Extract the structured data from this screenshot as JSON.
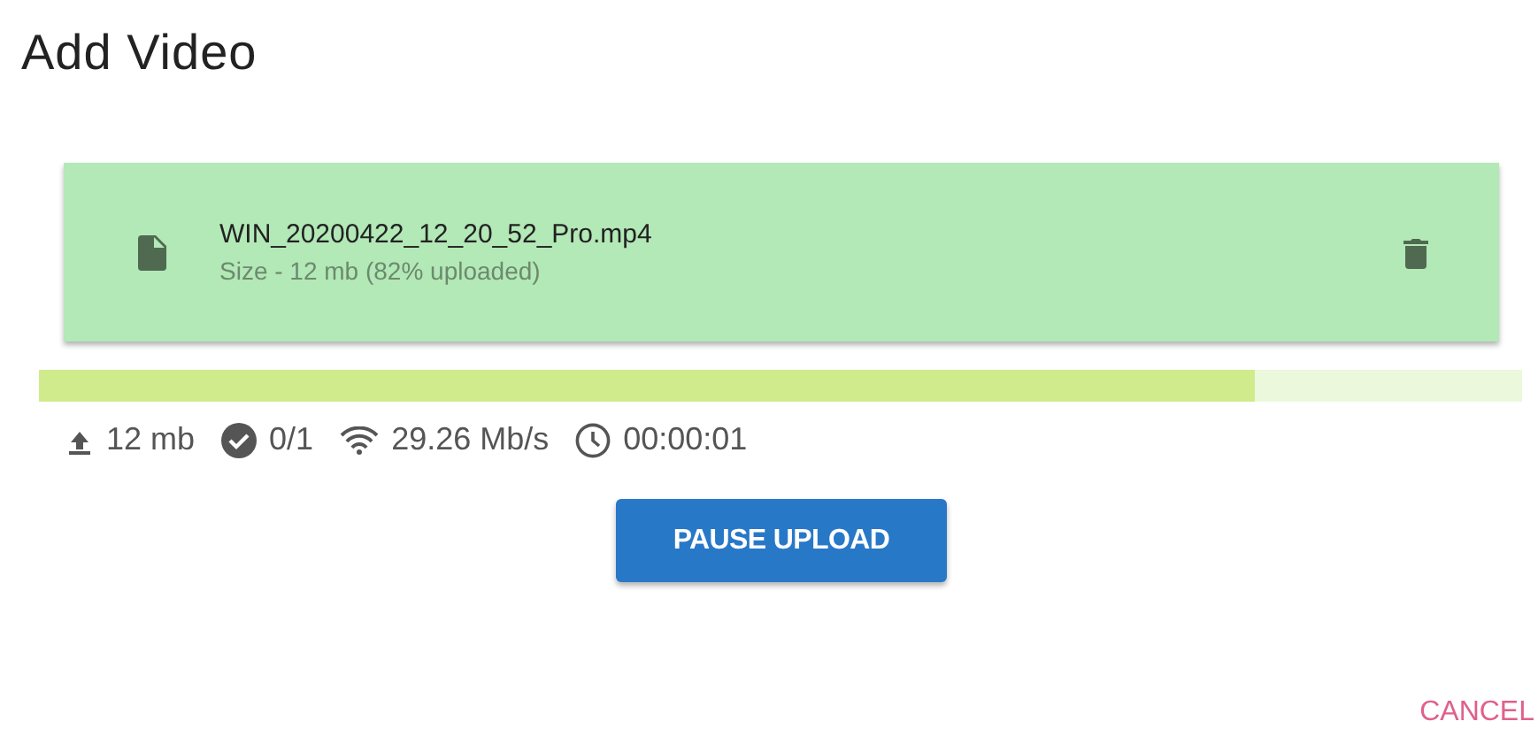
{
  "dialog": {
    "title": "Add Video"
  },
  "file": {
    "name": "WIN_20200422_12_20_52_Pro.mp4",
    "detail": "Size - 12 mb (82% uploaded)"
  },
  "progress": {
    "level": 0.82
  },
  "stats": [
    {
      "kind": "upload",
      "text": "12 mb"
    },
    {
      "kind": "done",
      "text": "0/1"
    },
    {
      "kind": "speed",
      "text": "29.26 Mb/s"
    },
    {
      "kind": "time",
      "text": "00:00:01"
    }
  ],
  "buttons": {
    "primary": "PAUSE UPLOAD",
    "cancel": "CANCEL"
  }
}
